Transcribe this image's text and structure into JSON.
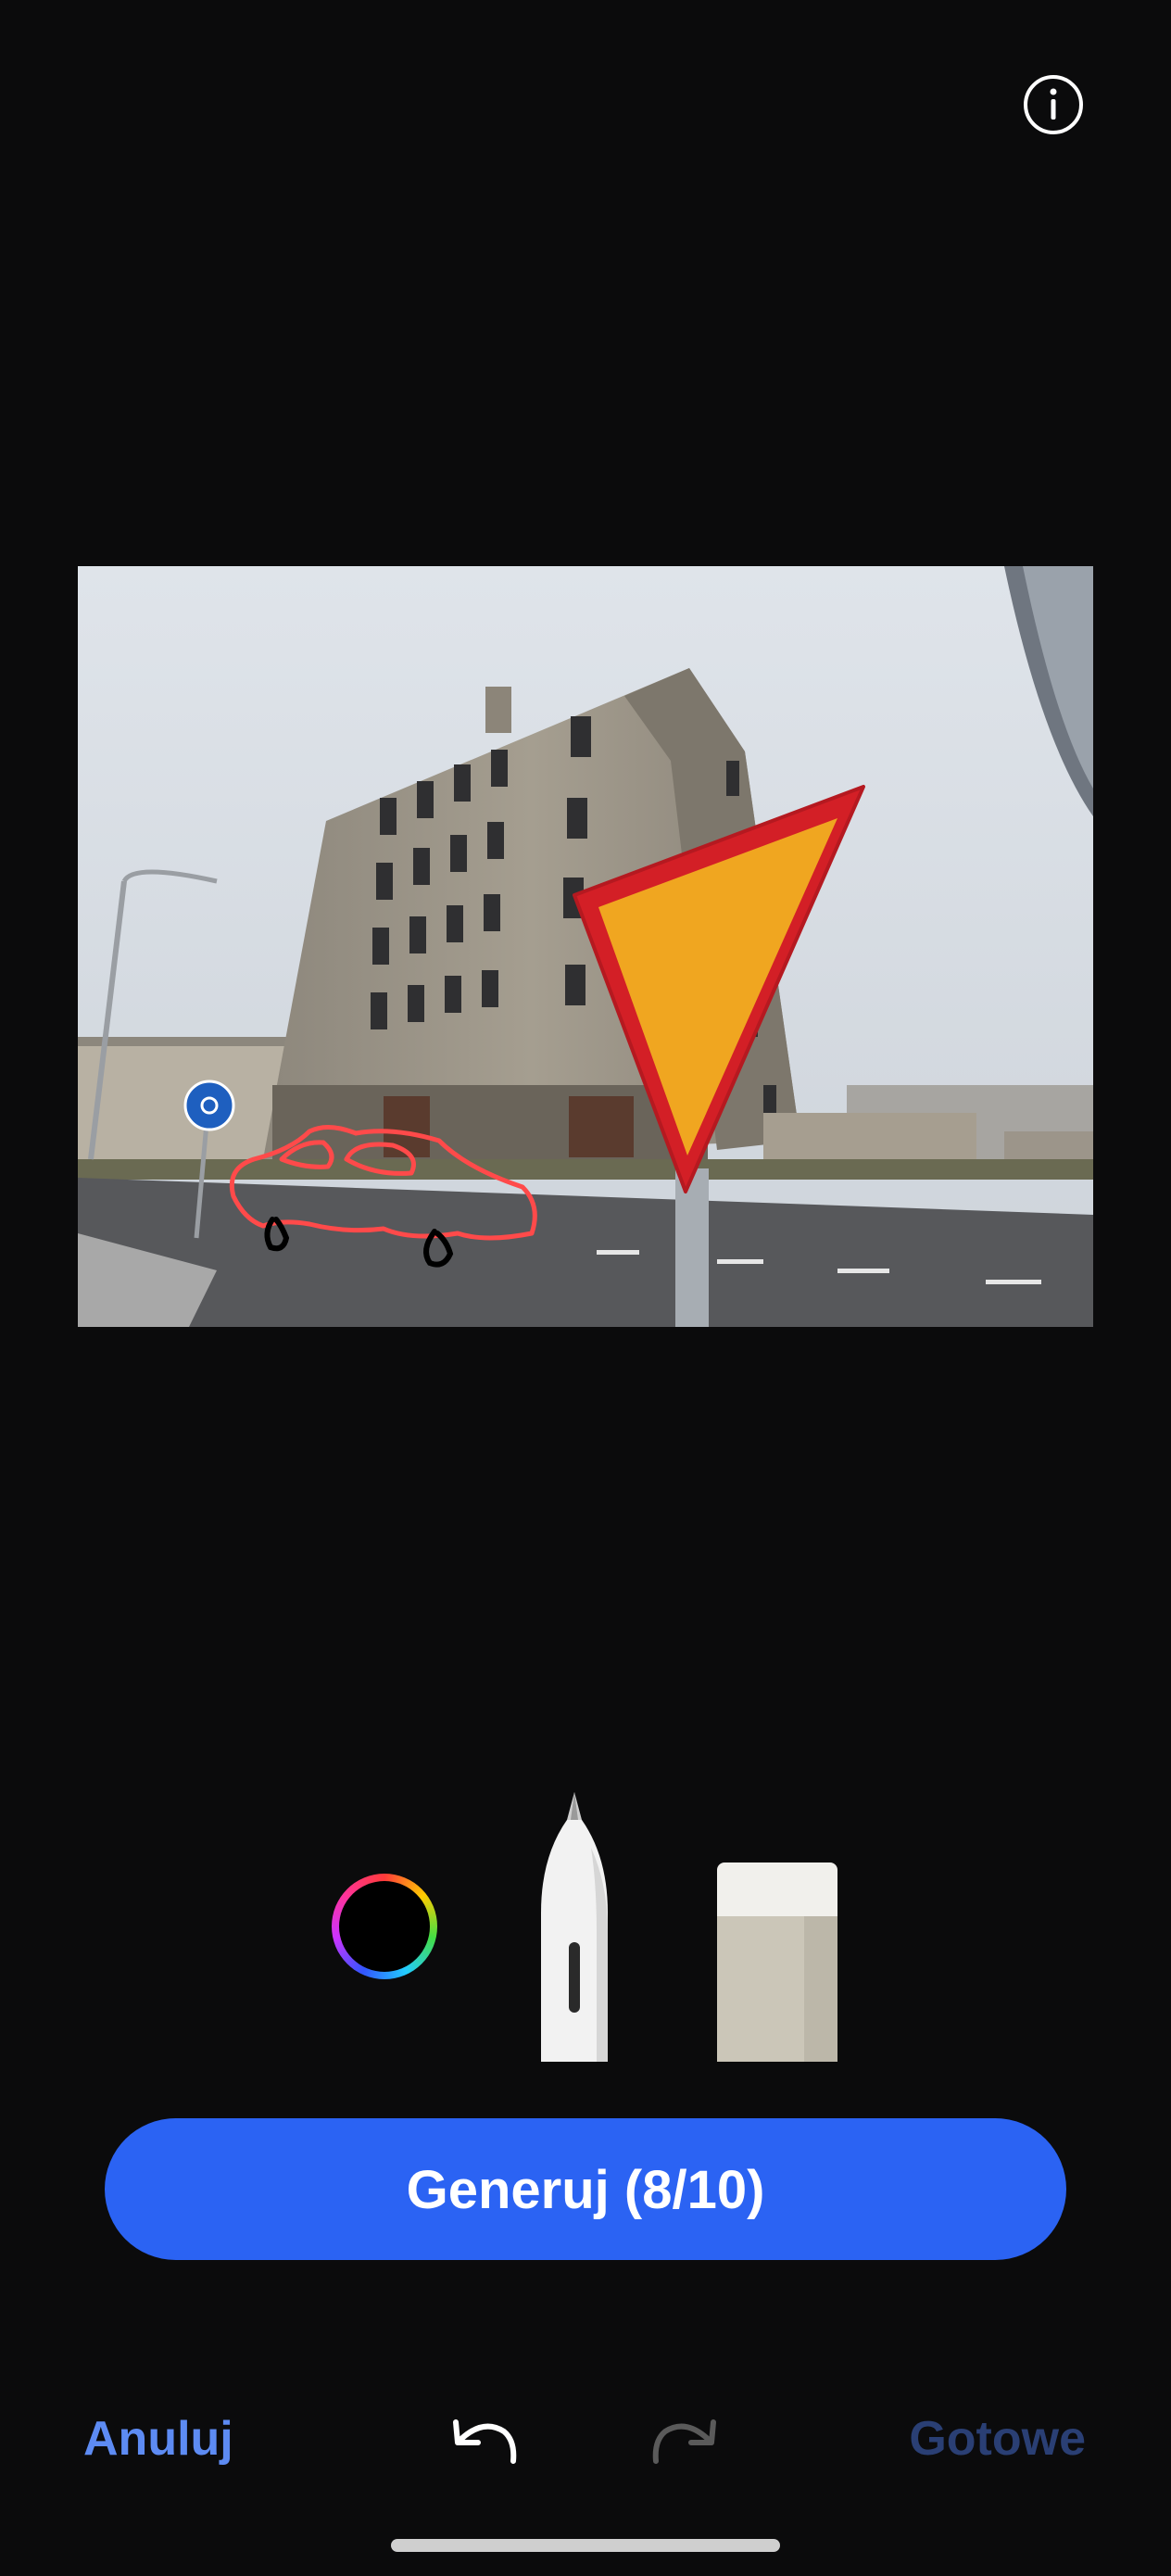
{
  "header": {
    "info_icon": "info-icon"
  },
  "canvas": {
    "image_subject": "photo",
    "sketch": {
      "stroke_colors": [
        "#ff4a4a",
        "#000000"
      ]
    }
  },
  "tools": {
    "color_picker_icon": "color-wheel-icon",
    "selected_color": "#000000",
    "pen_icon": "pen-icon",
    "eraser_icon": "eraser-icon"
  },
  "actions": {
    "generate_label": "Generuj (8/10)",
    "cancel_label": "Anuluj",
    "done_label": "Gotowe",
    "undo_icon": "undo-icon",
    "redo_icon": "redo-icon"
  },
  "colors": {
    "background": "#0b0b0c",
    "accent": "#2b63f3",
    "cancel_text": "#5d8bf3",
    "done_text_disabled": "#2a3f74"
  }
}
